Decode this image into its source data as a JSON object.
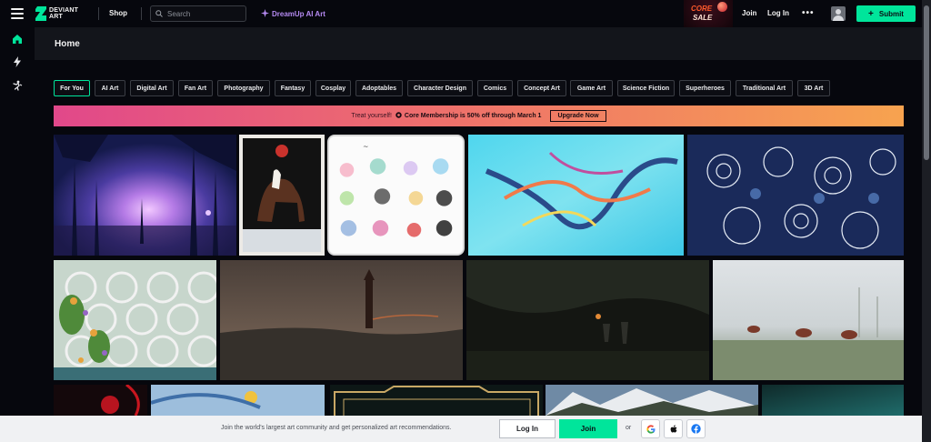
{
  "header": {
    "logo_line1": "DEVIANT",
    "logo_line2": "ART",
    "shop_label": "Shop",
    "search_placeholder": "Search",
    "dreamup_label": "DreamUp AI Art",
    "promo_line1": "CORE",
    "promo_line2": "SALE",
    "join_label": "Join",
    "login_label": "Log In",
    "more_label": "•••",
    "submit_label": "Submit",
    "submit_icon": "plus-icon"
  },
  "sidebar": {
    "items": [
      {
        "icon": "home-icon",
        "active": true
      },
      {
        "icon": "lightning-icon",
        "active": false
      },
      {
        "icon": "watch-figure-icon",
        "active": false
      }
    ]
  },
  "page": {
    "title": "Home"
  },
  "categories": [
    {
      "label": "For You",
      "active": true
    },
    {
      "label": "AI Art"
    },
    {
      "label": "Digital Art"
    },
    {
      "label": "Fan Art"
    },
    {
      "label": "Photography"
    },
    {
      "label": "Fantasy"
    },
    {
      "label": "Cosplay"
    },
    {
      "label": "Adoptables"
    },
    {
      "label": "Character Design"
    },
    {
      "label": "Comics"
    },
    {
      "label": "Concept Art"
    },
    {
      "label": "Game Art"
    },
    {
      "label": "Science Fiction"
    },
    {
      "label": "Superheroes"
    },
    {
      "label": "Traditional Art"
    },
    {
      "label": "3D Art"
    }
  ],
  "banner": {
    "intro": "Treat yourself!",
    "offer": "Core Membership is 50% off through March 1",
    "button": "Upgrade Now"
  },
  "joinbar": {
    "message": "Join the world's largest art community and get personalized art recommendations.",
    "login_label": "Log In",
    "join_label": "Join",
    "or_label": "or",
    "social": [
      "google-icon",
      "apple-icon",
      "facebook-icon"
    ]
  },
  "colors": {
    "accent": "#00e59b",
    "dreamup": "#b58af2",
    "background": "#06070d"
  }
}
